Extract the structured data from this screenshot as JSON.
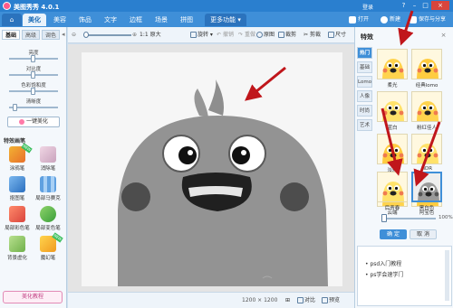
{
  "app": {
    "title": "美图秀秀 4.0.1",
    "account": "登录"
  },
  "main_tabs": [
    "美化",
    "美容",
    "饰品",
    "文字",
    "边框",
    "场景",
    "拼图",
    "更多功能"
  ],
  "top_buttons": {
    "open": "打开",
    "new": "新建",
    "save": "保存与分享"
  },
  "left_panel": {
    "subtabs": [
      "基础",
      "高级",
      "调色"
    ],
    "sliders": [
      {
        "label": "亮度",
        "value": 0.5
      },
      {
        "label": "对比度",
        "value": 0.5
      },
      {
        "label": "色彩饱和度",
        "value": 0.5
      },
      {
        "label": "清晰度",
        "value": 0.12
      }
    ],
    "one_key": "一键美化",
    "section_title": "特效画笔",
    "tools": [
      {
        "label": "涂鸦笔",
        "new": "NEW"
      },
      {
        "label": "消除笔",
        "new": ""
      },
      {
        "label": "抠图笔",
        "new": ""
      },
      {
        "label": "局部马赛克",
        "new": ""
      },
      {
        "label": "局部彩色笔",
        "new": ""
      },
      {
        "label": "局部变色笔",
        "new": ""
      },
      {
        "label": "背景虚化",
        "new": ""
      },
      {
        "label": "魔幻笔",
        "new": "NEW"
      }
    ],
    "bottom": "美化教程"
  },
  "toolbar": {
    "zoom_label": "1:1 原大",
    "rotate": "旋转",
    "undo": "撤销",
    "redo": "重做",
    "original": "原图",
    "crop": "裁剪",
    "cut": "剪裁",
    "size": "尺寸"
  },
  "status": {
    "dimensions": "1200 × 1200",
    "compare": "对比",
    "preview": "预览"
  },
  "right_panel": {
    "title": "特效",
    "categories": [
      "热门",
      "基础",
      "Lomo",
      "人像",
      "时尚",
      "艺术"
    ],
    "effects": [
      {
        "label": "柔光"
      },
      {
        "label": "经典lomo"
      },
      {
        "label": "蓝白"
      },
      {
        "label": "粉红佳人"
      },
      {
        "label": "淡雅"
      },
      {
        "label": "HDR"
      },
      {
        "label": "云端"
      },
      {
        "label": "阿宝色"
      },
      {
        "label": "后青春"
      },
      {
        "label": "黑白色"
      }
    ],
    "intensity": "100%",
    "intensity_value": 1.0,
    "ok": "确 定",
    "cancel": "取 消",
    "links": [
      "psd入门教程",
      "ps学会速学门"
    ]
  },
  "colors": {
    "accent": "#3f8fd8",
    "arrow": "#c0161b"
  }
}
